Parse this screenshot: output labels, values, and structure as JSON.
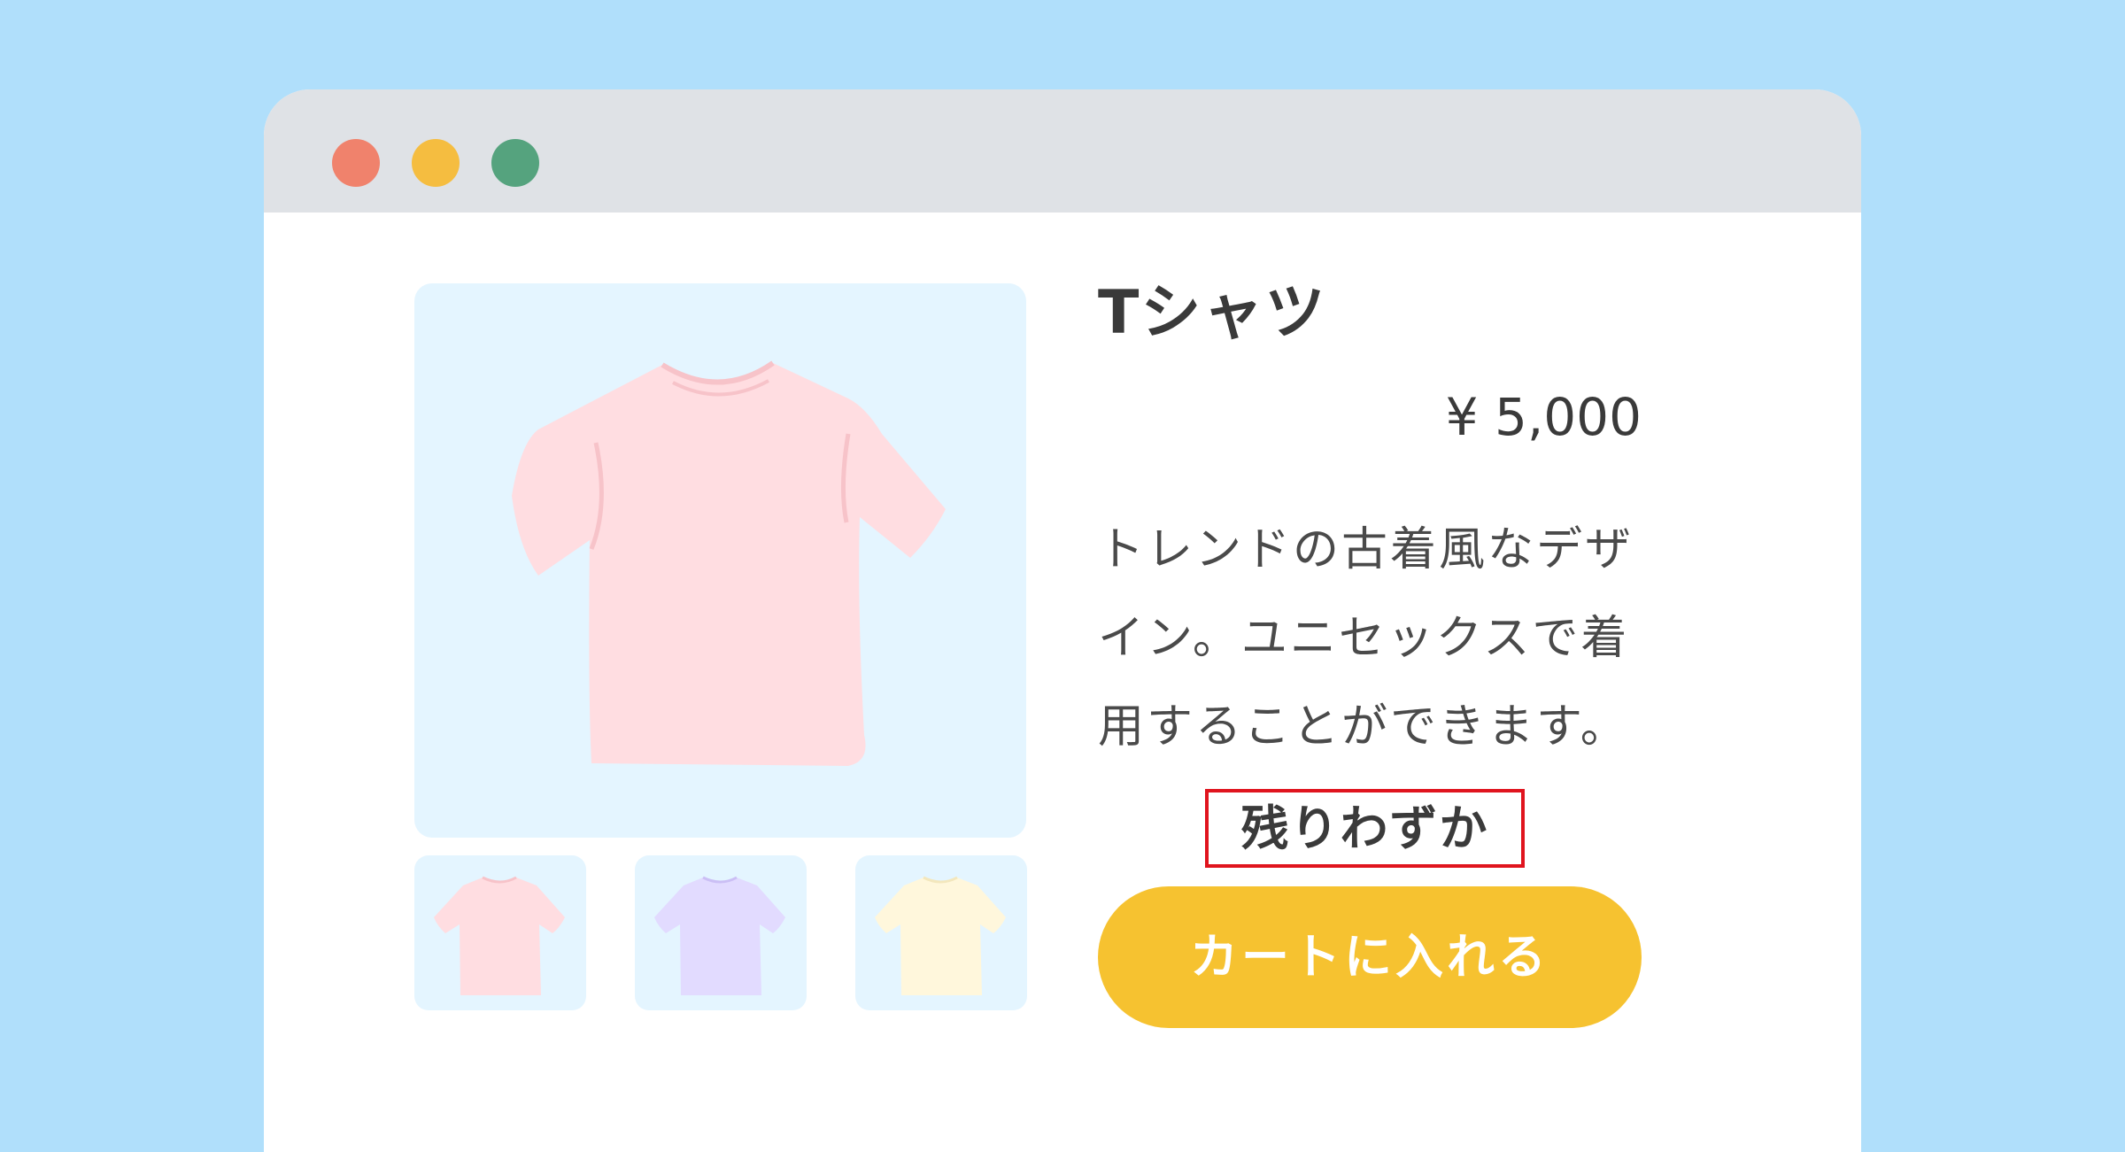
{
  "window_controls": {
    "close_color": "#f0826c",
    "minimize_color": "#f5bd40",
    "maximize_color": "#55a37e"
  },
  "product": {
    "title": "Tシャツ",
    "price": "¥ 5,000",
    "description_lines": [
      "トレンドの古着風なデザ",
      "イン。ユニセックスで着",
      "用することができます。"
    ],
    "stock_label": "残りわずか",
    "add_to_cart_label": "カートに入れる",
    "stock_border_color": "#e0141e",
    "button_color": "#f6c230"
  },
  "gallery": {
    "main_image": {
      "icon": "tshirt-icon",
      "color": "#ffdde1"
    },
    "thumbnails": [
      {
        "icon": "tshirt-icon",
        "color": "#ffdde1"
      },
      {
        "icon": "tshirt-icon",
        "color": "#e2dbff"
      },
      {
        "icon": "tshirt-icon",
        "color": "#fff7dc"
      }
    ]
  }
}
